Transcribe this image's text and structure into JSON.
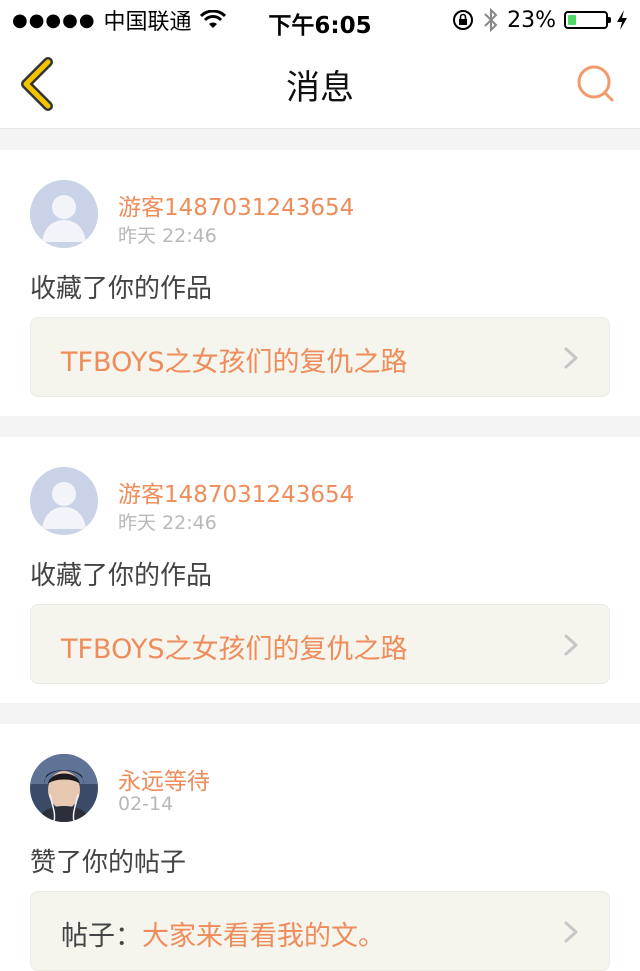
{
  "status_bar": {
    "signal": "●●●●●",
    "carrier": "中国联通",
    "time": "下午6:05",
    "battery_percent": "23%",
    "battery_level": 0.23
  },
  "nav": {
    "title": "消息"
  },
  "messages": [
    {
      "user": "游客1487031243654",
      "time": "昨天 22:46",
      "action": "收藏了你的作品",
      "ref_prefix": "",
      "ref_title": "TFBOYS之女孩们的复仇之路",
      "avatar": "default-avatar"
    },
    {
      "user": "游客1487031243654",
      "time": "昨天 22:46",
      "action": "收藏了你的作品",
      "ref_prefix": "",
      "ref_title": "TFBOYS之女孩们的复仇之路",
      "avatar": "default-avatar"
    },
    {
      "user": "永远等待",
      "time": "02-14",
      "action": "赞了你的帖子",
      "ref_prefix": "帖子：",
      "ref_title": "大家来看看我的文。",
      "avatar": "photo-avatar"
    }
  ],
  "colors": {
    "accent": "#ee8c5a",
    "nav_back": "#f5c400",
    "battery": "#4cd964"
  }
}
